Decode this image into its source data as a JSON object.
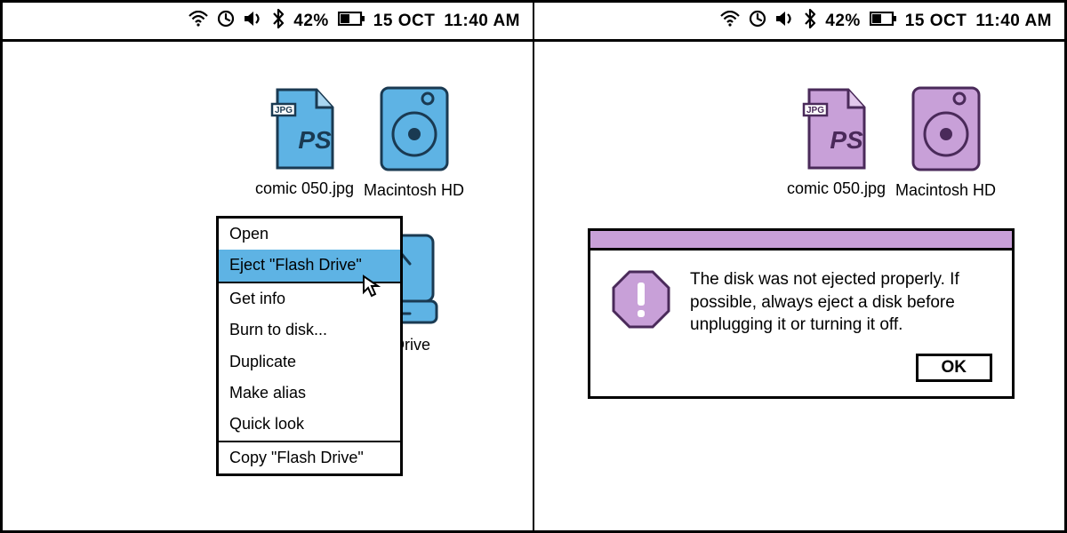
{
  "statusbar": {
    "battery_pct": "42%",
    "date": "15 OCT",
    "time": "11:40 AM"
  },
  "left": {
    "accent": "#5eb3e4",
    "icons": {
      "file": {
        "label": "comic 050.jpg",
        "badge": "JPG",
        "tag": "PS"
      },
      "hd": {
        "label": "Macintosh HD"
      },
      "flash": {
        "label": "Flash Drive"
      }
    },
    "context_menu": {
      "highlighted_index": 1,
      "groups": [
        [
          "Open",
          "Eject \"Flash Drive\""
        ],
        [
          "Get info",
          "Burn to disk...",
          "Duplicate",
          "Make alias",
          "Quick look"
        ],
        [
          "Copy \"Flash Drive\""
        ]
      ]
    }
  },
  "right": {
    "accent": "#c8a0d8",
    "icons": {
      "file": {
        "label": "comic 050.jpg",
        "badge": "JPG",
        "tag": "PS"
      },
      "hd": {
        "label": "Macintosh HD"
      }
    },
    "dialog": {
      "message": "The disk was not ejected properly. If possible, always eject a disk before unplugging it or turning it off.",
      "ok": "OK"
    }
  }
}
